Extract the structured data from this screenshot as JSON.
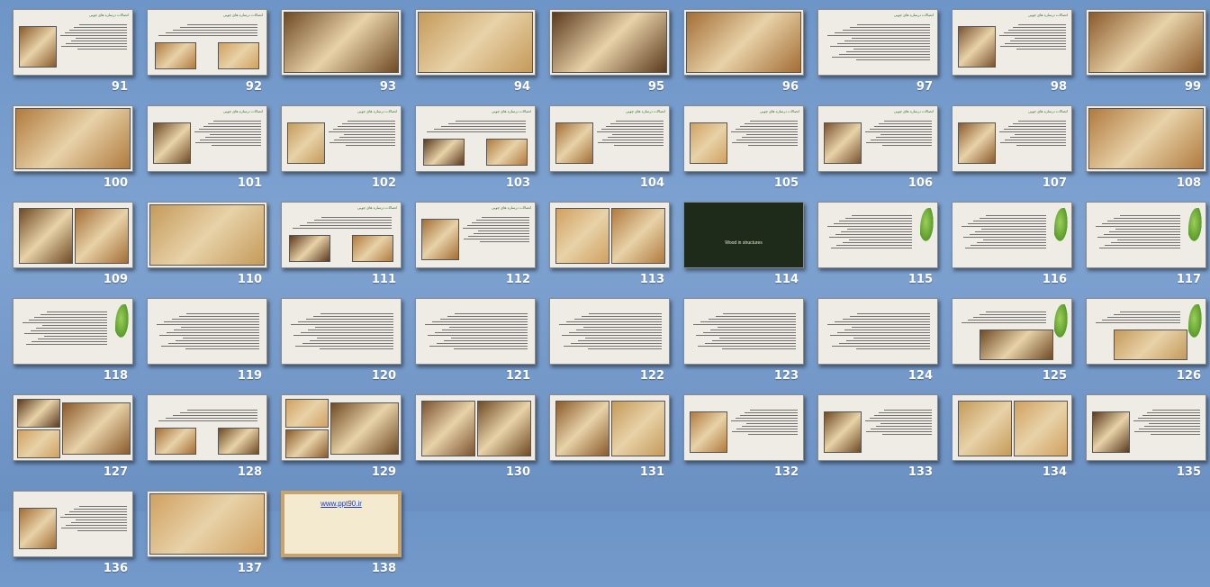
{
  "slides": [
    {
      "n": "91",
      "kind": "text-pic",
      "caption": "اتصالات درسازه های چوبی"
    },
    {
      "n": "92",
      "kind": "text-2pic",
      "caption": "اتصالات درسازه های چوبی"
    },
    {
      "n": "93",
      "kind": "photo"
    },
    {
      "n": "94",
      "kind": "photo"
    },
    {
      "n": "95",
      "kind": "photo"
    },
    {
      "n": "96",
      "kind": "photo"
    },
    {
      "n": "97",
      "kind": "text",
      "caption": "اتصالات درسازه های چوبی"
    },
    {
      "n": "98",
      "kind": "text-pic",
      "caption": "اتصالات درسازه های چوبی"
    },
    {
      "n": "99",
      "kind": "photo"
    },
    {
      "n": "100",
      "kind": "photo"
    },
    {
      "n": "101",
      "kind": "text-pic",
      "caption": "اتصالات درسازه های چوبی"
    },
    {
      "n": "102",
      "kind": "text-pic",
      "caption": "اتصالات درسازه های چوبی"
    },
    {
      "n": "103",
      "kind": "text-2pic",
      "caption": "اتصالات درسازه های چوبی"
    },
    {
      "n": "104",
      "kind": "text-pic",
      "caption": "اتصالات درسازه های چوبی"
    },
    {
      "n": "105",
      "kind": "text-pic",
      "caption": "اتصالات درسازه های چوبی"
    },
    {
      "n": "106",
      "kind": "text-pic",
      "caption": "اتصالات درسازه های چوبی"
    },
    {
      "n": "107",
      "kind": "text-pic",
      "caption": "اتصالات درسازه های چوبی"
    },
    {
      "n": "108",
      "kind": "photo"
    },
    {
      "n": "109",
      "kind": "photo2"
    },
    {
      "n": "110",
      "kind": "photo"
    },
    {
      "n": "111",
      "kind": "text-2pic",
      "caption": "اتصالات درسازه های چوبی"
    },
    {
      "n": "112",
      "kind": "text-pic",
      "caption": "اتصالات درسازه های چوبی"
    },
    {
      "n": "113",
      "kind": "photo2"
    },
    {
      "n": "114",
      "kind": "dark",
      "caption": "Wood in structures"
    },
    {
      "n": "115",
      "kind": "leaf-text"
    },
    {
      "n": "116",
      "kind": "leaf-text"
    },
    {
      "n": "117",
      "kind": "leaf-text"
    },
    {
      "n": "118",
      "kind": "leaf-text"
    },
    {
      "n": "119",
      "kind": "text"
    },
    {
      "n": "120",
      "kind": "text"
    },
    {
      "n": "121",
      "kind": "text"
    },
    {
      "n": "122",
      "kind": "text"
    },
    {
      "n": "123",
      "kind": "text"
    },
    {
      "n": "124",
      "kind": "text"
    },
    {
      "n": "125",
      "kind": "leaf-pic"
    },
    {
      "n": "126",
      "kind": "leaf-pic"
    },
    {
      "n": "127",
      "kind": "photo3"
    },
    {
      "n": "128",
      "kind": "text-2pic"
    },
    {
      "n": "129",
      "kind": "photo3"
    },
    {
      "n": "130",
      "kind": "photo2"
    },
    {
      "n": "131",
      "kind": "photo2"
    },
    {
      "n": "132",
      "kind": "text-pic"
    },
    {
      "n": "133",
      "kind": "text-pic"
    },
    {
      "n": "134",
      "kind": "photo2"
    },
    {
      "n": "135",
      "kind": "text-pic"
    },
    {
      "n": "136",
      "kind": "text-pic"
    },
    {
      "n": "137",
      "kind": "photo"
    },
    {
      "n": "138",
      "kind": "frame",
      "caption": "www.ppt90.ir"
    }
  ],
  "colors": {
    "background": "#7096c8",
    "slide": "#efece6",
    "number": "#ffffff",
    "title_green": "#2f6a2f",
    "title_red": "#9a1b1b"
  }
}
